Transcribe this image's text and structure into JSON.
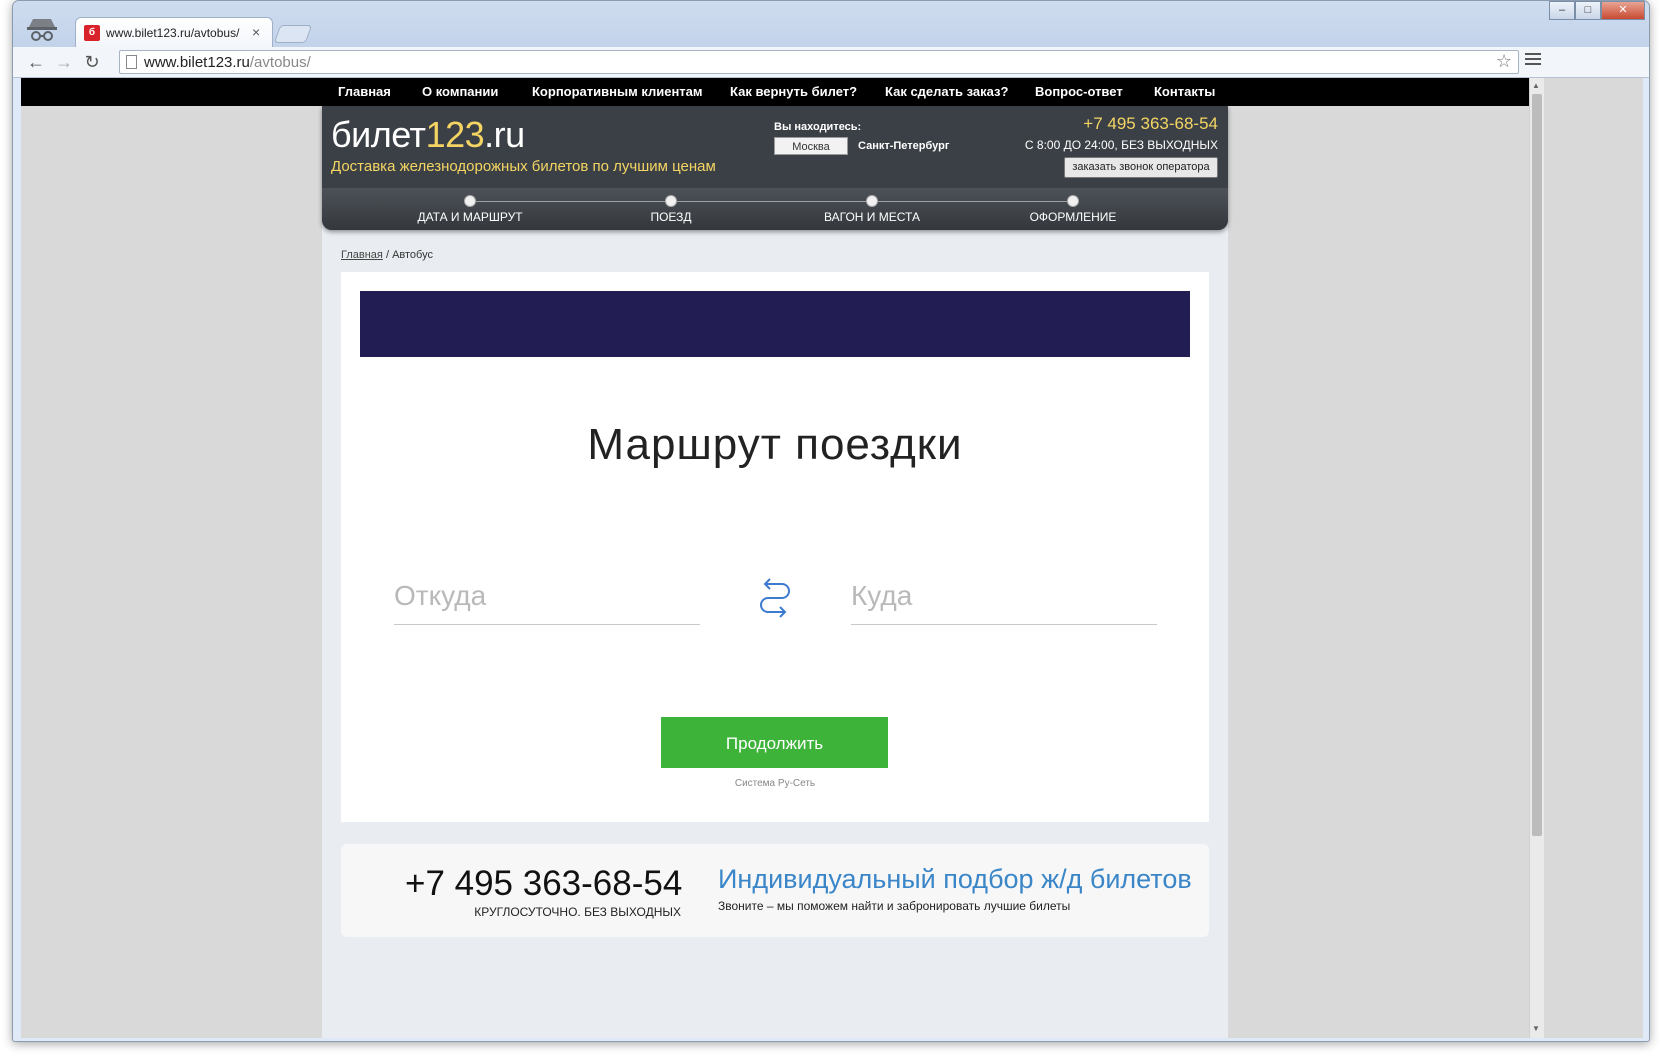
{
  "browser": {
    "tab_title": "www.bilet123.ru/avtobus/",
    "tab_close": "×",
    "url_host": "www.bilet123.ru",
    "url_path": "/avtobus/",
    "icons": [
      "incognito-icon",
      "back-icon",
      "forward-icon",
      "reload-icon",
      "page-icon",
      "star-icon",
      "menu-icon"
    ]
  },
  "topnav": {
    "items": [
      "Главная",
      "О компании",
      "Корпоративным клиентам",
      "Как вернуть билет?",
      "Как сделать заказ?",
      "Вопрос-ответ",
      "Контакты"
    ]
  },
  "header": {
    "logo_text": "билет",
    "logo_number": "123",
    "logo_suffix": ".ru",
    "tagline": "Доставка железнодорожных билетов по лучшим ценам",
    "location_label": "Вы находитесь:",
    "city_selected": "Москва",
    "city_other": "Санкт-Петербург",
    "phone": "+7 495 363-68-54",
    "hours": "С 8:00 ДО 24:00, БЕЗ ВЫХОДНЫХ",
    "callback_label": "заказать звонок оператора",
    "accent_color": "#f4d563"
  },
  "steps": [
    "ДАТА И МАРШРУТ",
    "ПОЕЗД",
    "ВАГОН И МЕСТА",
    "ОФОРМЛЕНИЕ"
  ],
  "breadcrumb": {
    "home": "Главная",
    "separator": "/",
    "current": "Автобус"
  },
  "route_form": {
    "title": "Маршрут поездки",
    "from_placeholder": "Откуда",
    "to_placeholder": "Куда",
    "continue_label": "Продолжить",
    "system_caption": "Система Ру-Сеть",
    "button_color": "#3db33a"
  },
  "bottom": {
    "phone": "+7 495 363-68-54",
    "phone_note": "КРУГЛОСУТОЧНО. БЕЗ ВЫХОДНЫХ",
    "title": "Индивидуальный подбор ж/д билетов",
    "subtitle": "Звоните – мы поможем найти и забронировать лучшие билеты"
  }
}
